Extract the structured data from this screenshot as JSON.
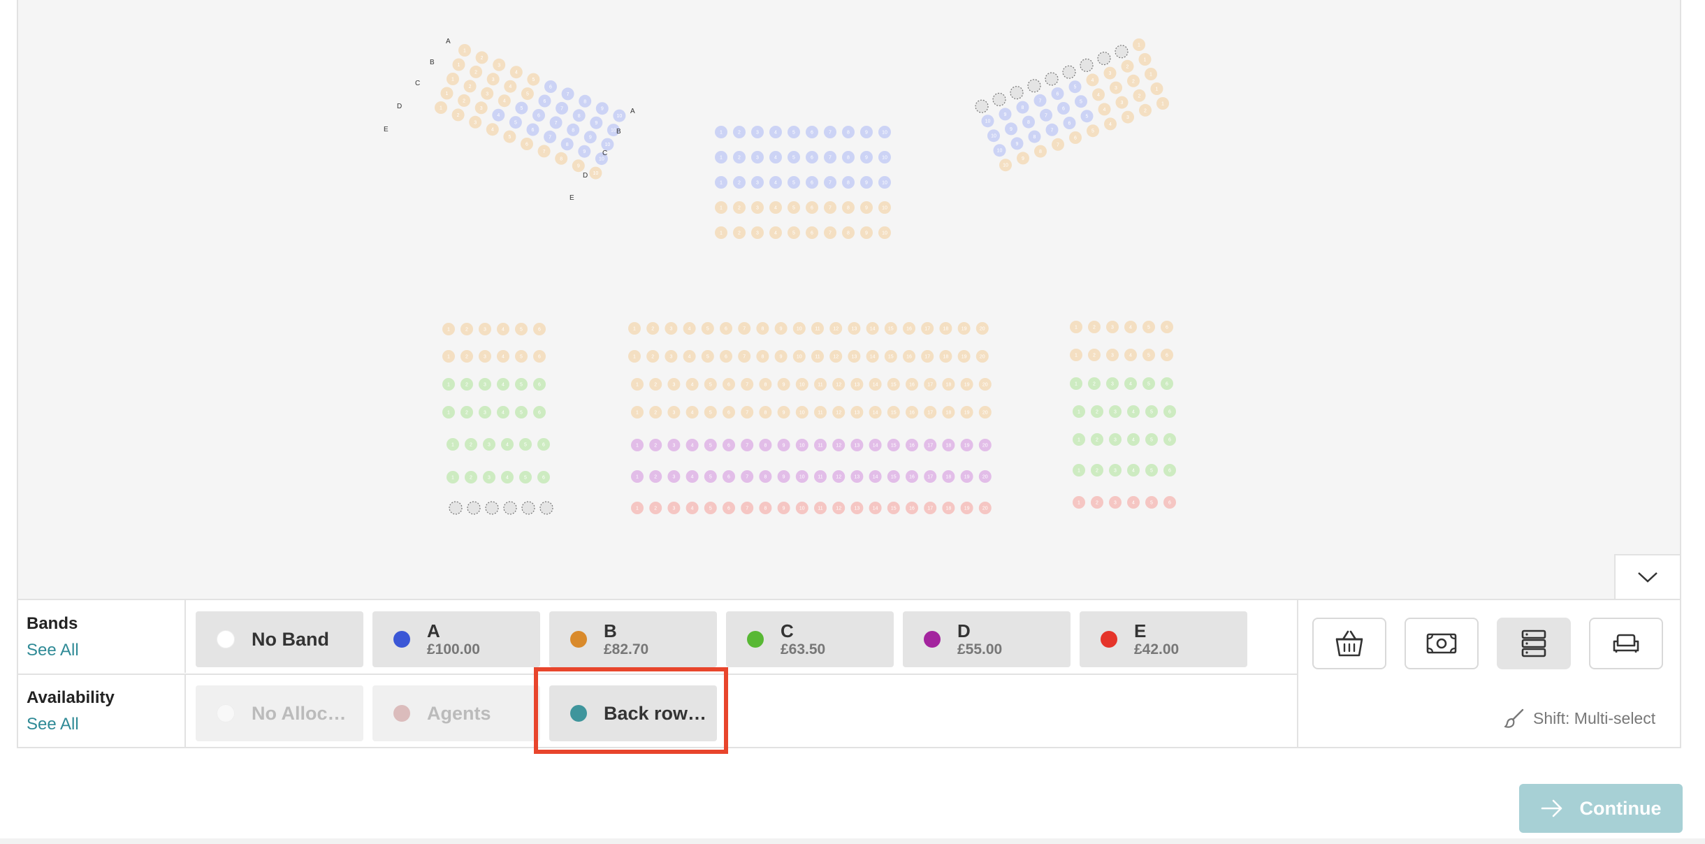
{
  "bands": {
    "label": "Bands",
    "see_all": "See All",
    "items": [
      {
        "name": "No Band",
        "price": "",
        "color": "#ffffff"
      },
      {
        "name": "A",
        "price": "£100.00",
        "color": "#3b57d6"
      },
      {
        "name": "B",
        "price": "£82.70",
        "color": "#d98a2b"
      },
      {
        "name": "C",
        "price": "£63.50",
        "color": "#58b834"
      },
      {
        "name": "D",
        "price": "£55.00",
        "color": "#a3249e"
      },
      {
        "name": "E",
        "price": "£42.00",
        "color": "#e5342a"
      }
    ]
  },
  "availability": {
    "label": "Availability",
    "see_all": "See All",
    "items": [
      {
        "name": "No Alloc…",
        "color": "#f8f8f8"
      },
      {
        "name": "Agents",
        "color": "#dbbcbc"
      },
      {
        "name": "Back row…",
        "color": "#3f959c"
      }
    ]
  },
  "tools": [
    {
      "icon": "basket-icon",
      "active": false
    },
    {
      "icon": "banknote-icon",
      "active": false
    },
    {
      "icon": "server-stack-icon",
      "active": true
    },
    {
      "icon": "sofa-icon",
      "active": false
    }
  ],
  "hint": "Shift: Multi-select",
  "continue_label": "Continue",
  "seatmap": {
    "row_labels_left": [
      "A",
      "B",
      "C",
      "D",
      "E"
    ],
    "row_labels_right": [
      "A",
      "B",
      "C",
      "D",
      "E"
    ]
  },
  "colors": {
    "band_a_seat": "#ccd3f5",
    "band_b_seat": "#f4dfc2",
    "band_c_seat": "#cdebc1",
    "band_d_seat": "#e2bde8",
    "band_e_seat": "#f5c6c3",
    "accent": "#2f8a96",
    "continue_bg": "#a7d0d5",
    "highlight": "#e8452c"
  }
}
